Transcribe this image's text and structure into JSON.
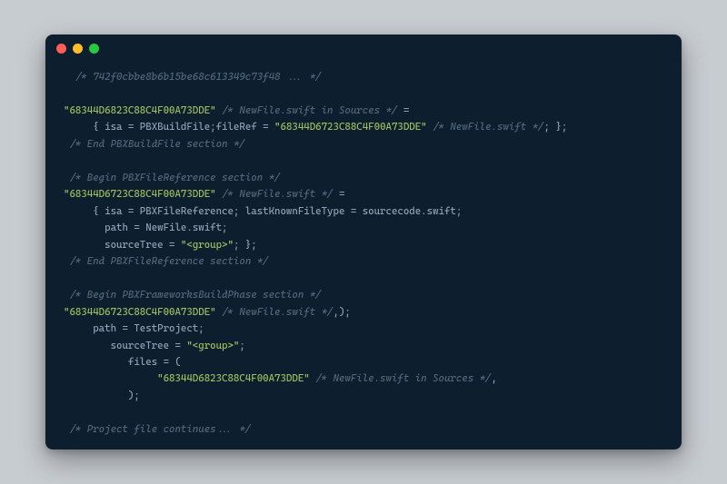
{
  "lines": [
    {
      "indent": 2,
      "tokens": [
        {
          "cls": "comment",
          "t": "/* 742f0cbbe8b6b15be68c613349c73f48 ... */"
        }
      ]
    },
    {
      "indent": 0,
      "tokens": []
    },
    {
      "indent": 0,
      "tokens": [
        {
          "cls": "string",
          "t": "\"68344D6823C88C4F00A73DDE\""
        },
        {
          "cls": "punct",
          "t": " "
        },
        {
          "cls": "comment",
          "t": "/* NewFile.swift in Sources */"
        },
        {
          "cls": "punct",
          "t": " ="
        }
      ]
    },
    {
      "indent": 5,
      "tokens": [
        {
          "cls": "punct",
          "t": "{ "
        },
        {
          "cls": "keyword",
          "t": "isa = PBXBuildFile"
        },
        {
          "cls": "punct",
          "t": ";"
        },
        {
          "cls": "keyword",
          "t": "fileRef = "
        },
        {
          "cls": "string",
          "t": "\"68344D6723C88C4F00A73DDE\""
        },
        {
          "cls": "punct",
          "t": " "
        },
        {
          "cls": "comment",
          "t": "/* NewFile.swift */"
        },
        {
          "cls": "punct",
          "t": "; };"
        }
      ]
    },
    {
      "indent": 1,
      "tokens": [
        {
          "cls": "comment",
          "t": "/* End PBXBuildFile section */"
        }
      ]
    },
    {
      "indent": 0,
      "tokens": []
    },
    {
      "indent": 1,
      "tokens": [
        {
          "cls": "comment",
          "t": "/* Begin PBXFileReference section */"
        }
      ]
    },
    {
      "indent": 0,
      "tokens": [
        {
          "cls": "string",
          "t": "\"68344D6723C88C4F00A73DDE\""
        },
        {
          "cls": "punct",
          "t": " "
        },
        {
          "cls": "comment",
          "t": "/* NewFile.swift */"
        },
        {
          "cls": "punct",
          "t": " ="
        }
      ]
    },
    {
      "indent": 5,
      "tokens": [
        {
          "cls": "punct",
          "t": "{ "
        },
        {
          "cls": "keyword",
          "t": "isa = PBXFileReference; lastKnownFileType = sourcecode"
        },
        {
          "cls": "dot-op",
          "t": "."
        },
        {
          "cls": "keyword",
          "t": "swift;"
        }
      ]
    },
    {
      "indent": 7,
      "tokens": [
        {
          "cls": "keyword",
          "t": "path = NewFile"
        },
        {
          "cls": "dot-op",
          "t": "."
        },
        {
          "cls": "keyword",
          "t": "swift;"
        }
      ]
    },
    {
      "indent": 7,
      "tokens": [
        {
          "cls": "keyword",
          "t": "sourceTree = "
        },
        {
          "cls": "string",
          "t": "\"<group>\""
        },
        {
          "cls": "punct",
          "t": "; };"
        }
      ]
    },
    {
      "indent": 1,
      "tokens": [
        {
          "cls": "comment",
          "t": "/* End PBXFileReference section */"
        }
      ]
    },
    {
      "indent": 0,
      "tokens": []
    },
    {
      "indent": 1,
      "tokens": [
        {
          "cls": "comment",
          "t": "/* Begin PBXFrameworksBuildPhase section */"
        }
      ]
    },
    {
      "indent": 0,
      "tokens": [
        {
          "cls": "string",
          "t": "\"68344D6723C88C4F00A73DDE\""
        },
        {
          "cls": "punct",
          "t": " "
        },
        {
          "cls": "comment",
          "t": "/* NewFile.swift */"
        },
        {
          "cls": "punct",
          "t": ",);"
        }
      ]
    },
    {
      "indent": 5,
      "tokens": [
        {
          "cls": "keyword",
          "t": "path = TestProject;"
        }
      ]
    },
    {
      "indent": 8,
      "tokens": [
        {
          "cls": "keyword",
          "t": "sourceTree = "
        },
        {
          "cls": "string",
          "t": "\"<group>\""
        },
        {
          "cls": "punct",
          "t": ";"
        }
      ]
    },
    {
      "indent": 11,
      "tokens": [
        {
          "cls": "keyword",
          "t": "files = ("
        }
      ]
    },
    {
      "indent": 16,
      "tokens": [
        {
          "cls": "string",
          "t": "\"68344D6823C88C4F00A73DDE\""
        },
        {
          "cls": "punct",
          "t": " "
        },
        {
          "cls": "comment",
          "t": "/* NewFile.swift in Sources */"
        },
        {
          "cls": "punct",
          "t": ","
        }
      ]
    },
    {
      "indent": 11,
      "tokens": [
        {
          "cls": "punct",
          "t": ");"
        }
      ]
    },
    {
      "indent": 0,
      "tokens": []
    },
    {
      "indent": 1,
      "tokens": [
        {
          "cls": "comment",
          "t": "/* Project file continues... */"
        }
      ]
    }
  ]
}
